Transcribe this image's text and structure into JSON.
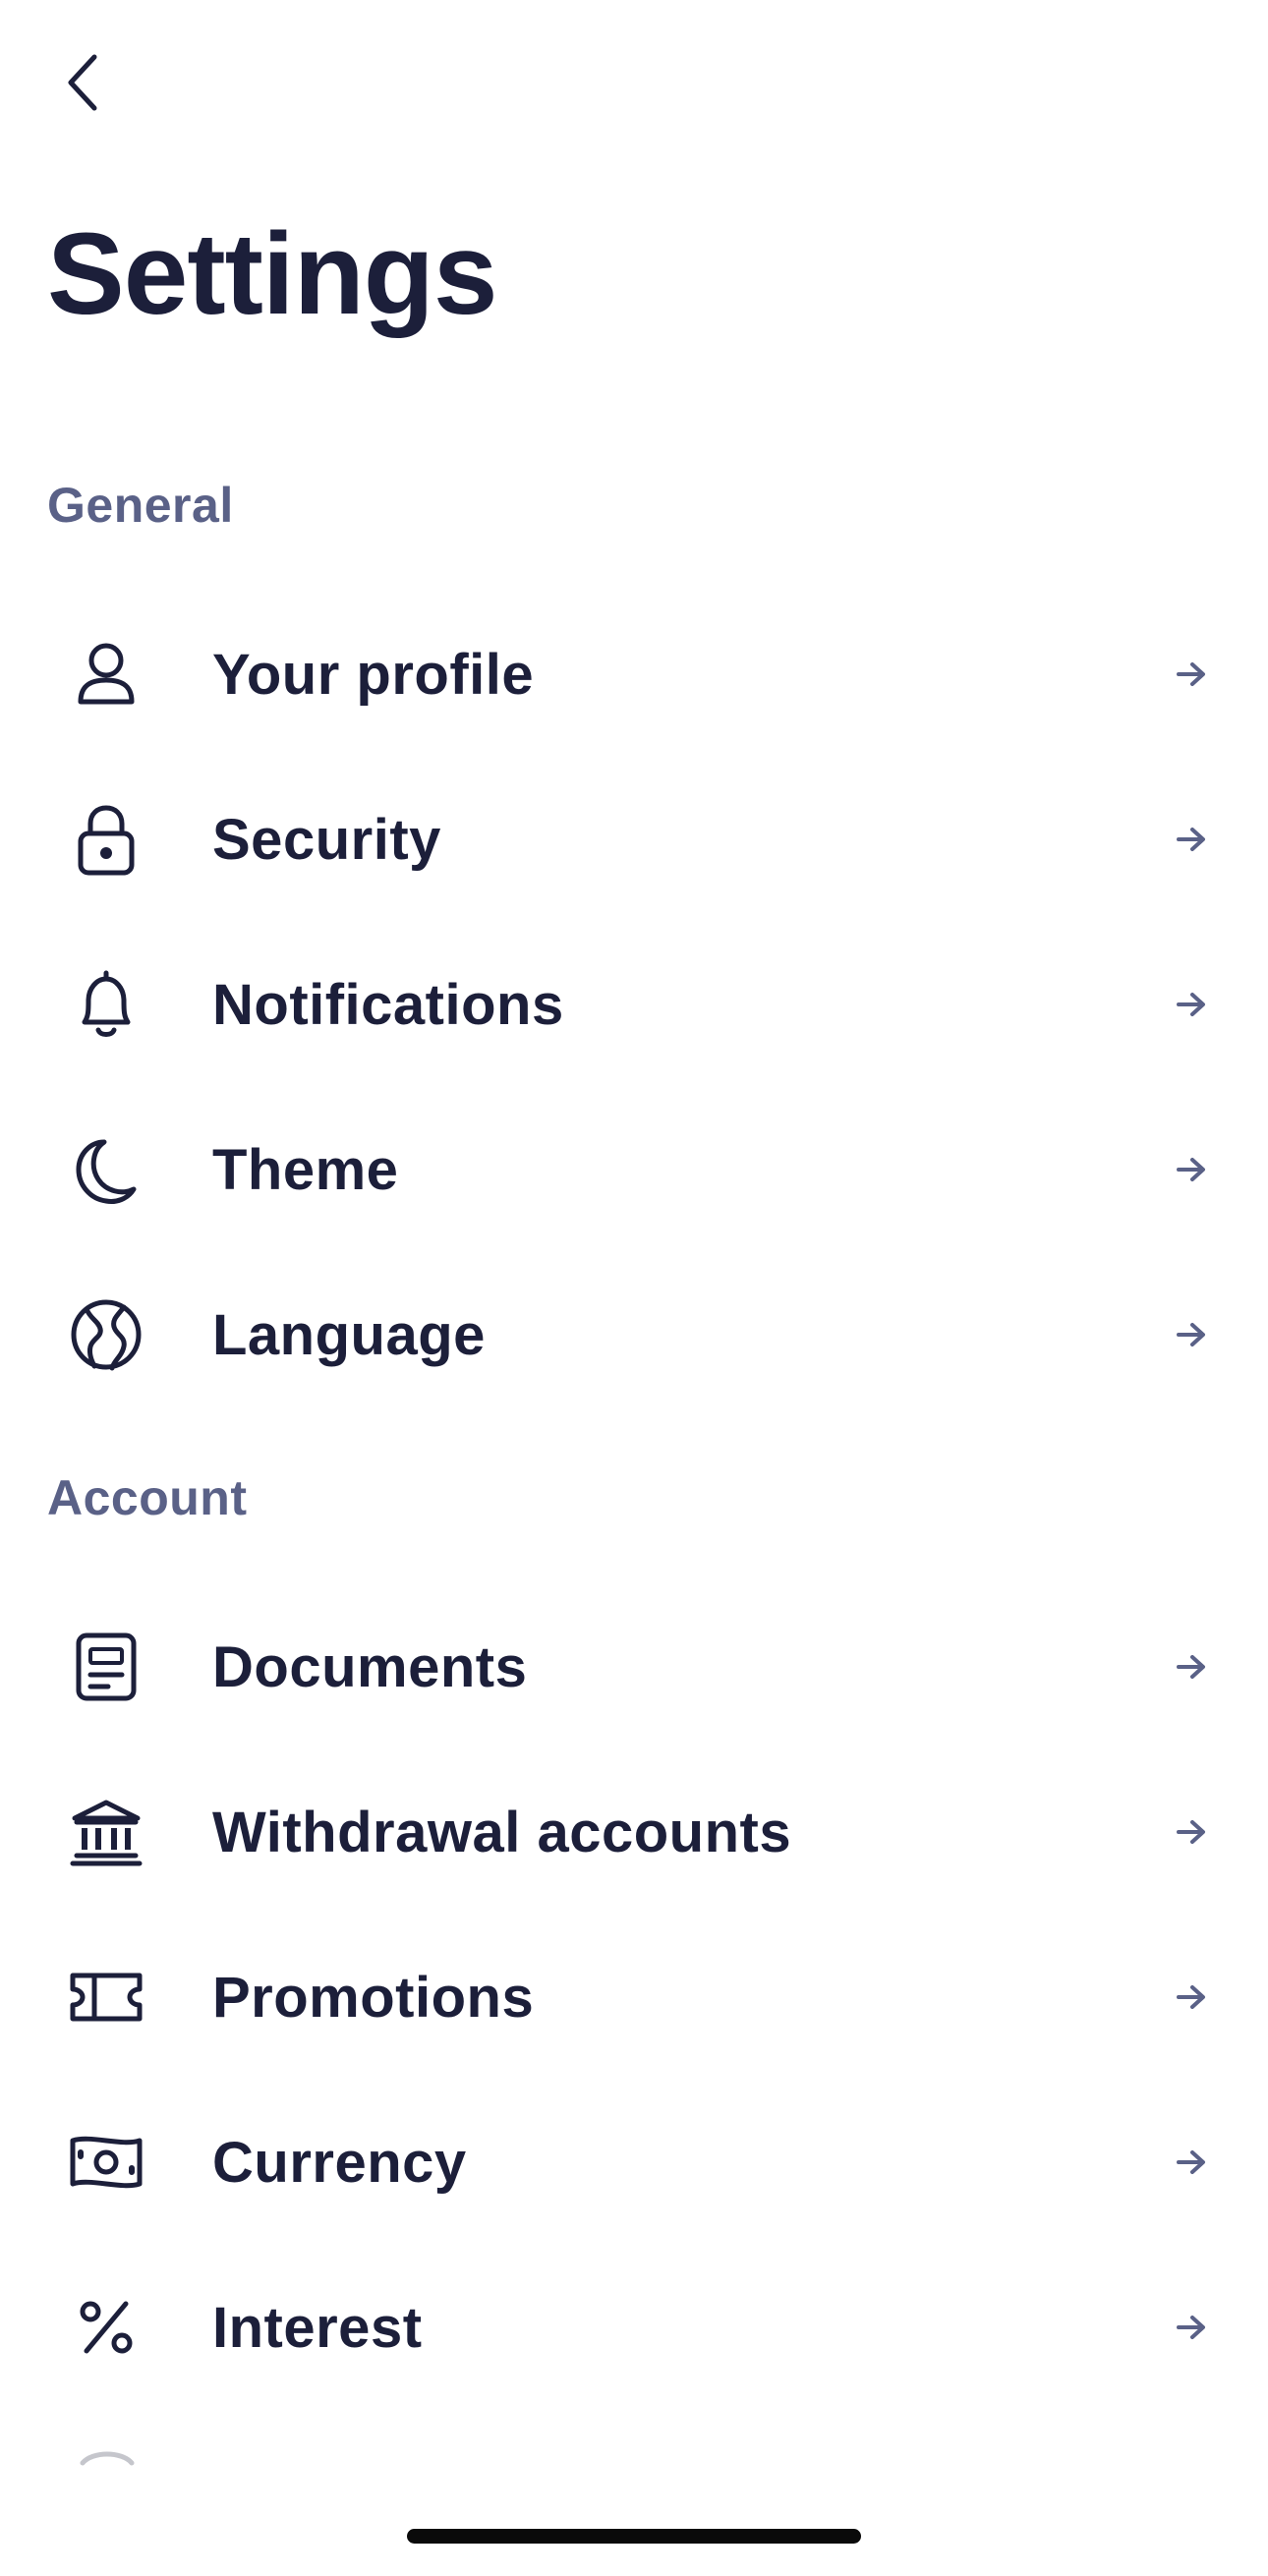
{
  "header": {
    "back_icon": "chevron-left-icon",
    "title": "Settings"
  },
  "sections": [
    {
      "label": "General",
      "items": [
        {
          "label": "Your profile",
          "icon": "user-icon"
        },
        {
          "label": "Security",
          "icon": "lock-icon"
        },
        {
          "label": "Notifications",
          "icon": "bell-icon"
        },
        {
          "label": "Theme",
          "icon": "moon-icon"
        },
        {
          "label": "Language",
          "icon": "globe-icon"
        }
      ]
    },
    {
      "label": "Account",
      "items": [
        {
          "label": "Documents",
          "icon": "document-icon"
        },
        {
          "label": "Withdrawal accounts",
          "icon": "bank-icon"
        },
        {
          "label": "Promotions",
          "icon": "ticket-icon"
        },
        {
          "label": "Currency",
          "icon": "banknote-icon"
        },
        {
          "label": "Interest",
          "icon": "percent-icon"
        }
      ]
    }
  ],
  "row_arrow_icon": "arrow-right-icon",
  "colors": {
    "text": "#1c1f3a",
    "section_label": "#5a6187",
    "arrow": "#5a6187",
    "background": "#ffffff"
  }
}
